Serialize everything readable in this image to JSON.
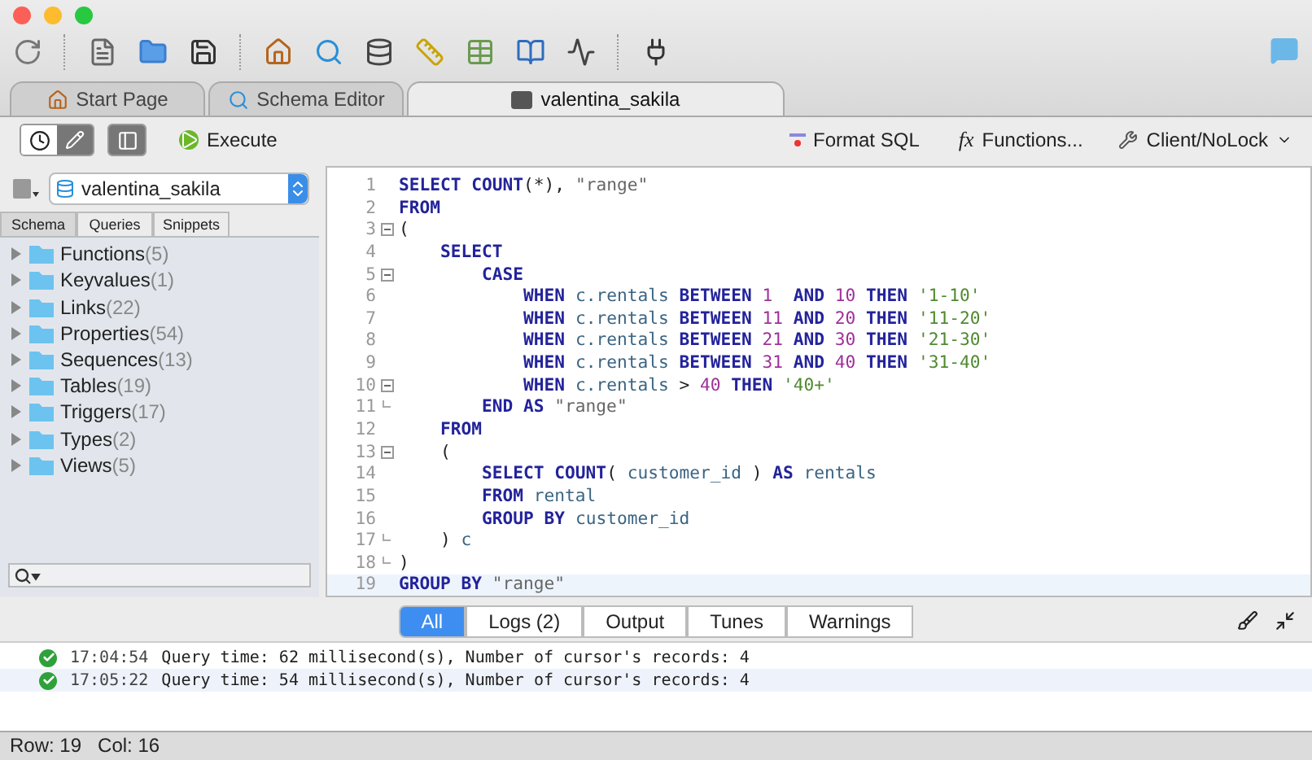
{
  "tabs": [
    {
      "label": "Start Page",
      "kind": "home",
      "selected": false
    },
    {
      "label": "Schema Editor",
      "kind": "schema",
      "selected": false
    },
    {
      "label": "valentina_sakila",
      "kind": "sql",
      "selected": true
    }
  ],
  "actions": {
    "execute": "Execute",
    "format": "Format SQL",
    "functions_icon": "fx",
    "functions": "Functions...",
    "client": "Client/NoLock"
  },
  "database": "valentina_sakila",
  "sidebar_tabs": [
    {
      "label": "Schema",
      "selected": true
    },
    {
      "label": "Queries",
      "selected": false
    },
    {
      "label": "Snippets",
      "selected": false
    }
  ],
  "tree": [
    {
      "name": "Functions",
      "count": "(5)",
      "expanded": false
    },
    {
      "name": "Keyvalues",
      "count": "(1)",
      "expanded": false
    },
    {
      "name": "Links",
      "count": "(22)",
      "expanded": false
    },
    {
      "name": "Properties",
      "count": "(54)",
      "expanded": false
    },
    {
      "name": "Sequences",
      "count": "(13)",
      "expanded": false
    },
    {
      "name": "Tables",
      "count": "(19)",
      "expanded": false
    },
    {
      "name": "Triggers",
      "count": "(17)",
      "expanded": false
    },
    {
      "name": "Types",
      "count": "(2)",
      "expanded": false
    },
    {
      "name": "Views",
      "count": "(5)",
      "expanded": false
    }
  ],
  "editor": {
    "lines": [
      {
        "number": "1",
        "tokens": [
          {
            "kind": "kw",
            "text": "SELECT COUNT"
          },
          {
            "kind": "punct",
            "text": "(*), "
          },
          {
            "kind": "qid",
            "text": "\"range\""
          }
        ]
      },
      {
        "number": "2",
        "tokens": [
          {
            "kind": "kw",
            "text": "FROM"
          }
        ]
      },
      {
        "number": "3",
        "fold_open": true,
        "tokens": [
          {
            "kind": "punct",
            "text": "("
          }
        ]
      },
      {
        "number": "4",
        "tokens": [
          {
            "kind": "kw",
            "text": "    SELECT"
          }
        ]
      },
      {
        "number": "5",
        "fold_open": true,
        "tokens": [
          {
            "kind": "kw",
            "text": "        CASE"
          }
        ]
      },
      {
        "number": "6",
        "tokens": [
          {
            "kind": "kw",
            "text": "            WHEN "
          },
          {
            "kind": "id",
            "text": "c.rentals "
          },
          {
            "kind": "kw",
            "text": "BETWEEN "
          },
          {
            "kind": "num",
            "text": "1  "
          },
          {
            "kind": "kw",
            "text": "AND "
          },
          {
            "kind": "num",
            "text": "10 "
          },
          {
            "kind": "kw",
            "text": "THEN "
          },
          {
            "kind": "str",
            "text": "'1-10'"
          }
        ]
      },
      {
        "number": "7",
        "tokens": [
          {
            "kind": "kw",
            "text": "            WHEN "
          },
          {
            "kind": "id",
            "text": "c.rentals "
          },
          {
            "kind": "kw",
            "text": "BETWEEN "
          },
          {
            "kind": "num",
            "text": "11 "
          },
          {
            "kind": "kw",
            "text": "AND "
          },
          {
            "kind": "num",
            "text": "20 "
          },
          {
            "kind": "kw",
            "text": "THEN "
          },
          {
            "kind": "str",
            "text": "'11-20'"
          }
        ]
      },
      {
        "number": "8",
        "tokens": [
          {
            "kind": "kw",
            "text": "            WHEN "
          },
          {
            "kind": "id",
            "text": "c.rentals "
          },
          {
            "kind": "kw",
            "text": "BETWEEN "
          },
          {
            "kind": "num",
            "text": "21 "
          },
          {
            "kind": "kw",
            "text": "AND "
          },
          {
            "kind": "num",
            "text": "30 "
          },
          {
            "kind": "kw",
            "text": "THEN "
          },
          {
            "kind": "str",
            "text": "'21-30'"
          }
        ]
      },
      {
        "number": "9",
        "tokens": [
          {
            "kind": "kw",
            "text": "            WHEN "
          },
          {
            "kind": "id",
            "text": "c.rentals "
          },
          {
            "kind": "kw",
            "text": "BETWEEN "
          },
          {
            "kind": "num",
            "text": "31 "
          },
          {
            "kind": "kw",
            "text": "AND "
          },
          {
            "kind": "num",
            "text": "40 "
          },
          {
            "kind": "kw",
            "text": "THEN "
          },
          {
            "kind": "str",
            "text": "'31-40'"
          }
        ]
      },
      {
        "number": "10",
        "fold_open": true,
        "tokens": [
          {
            "kind": "kw",
            "text": "            WHEN "
          },
          {
            "kind": "id",
            "text": "c.rentals "
          },
          {
            "kind": "punct",
            "text": "> "
          },
          {
            "kind": "num",
            "text": "40 "
          },
          {
            "kind": "kw",
            "text": "THEN "
          },
          {
            "kind": "str",
            "text": "'40+'"
          }
        ]
      },
      {
        "number": "11",
        "fold_end": true,
        "tokens": [
          {
            "kind": "kw",
            "text": "        END AS "
          },
          {
            "kind": "qid",
            "text": "\"range\""
          }
        ]
      },
      {
        "number": "12",
        "tokens": [
          {
            "kind": "kw",
            "text": "    FROM"
          }
        ]
      },
      {
        "number": "13",
        "fold_open": true,
        "tokens": [
          {
            "kind": "punct",
            "text": "    ("
          }
        ]
      },
      {
        "number": "14",
        "tokens": [
          {
            "kind": "kw",
            "text": "        SELECT COUNT"
          },
          {
            "kind": "punct",
            "text": "( "
          },
          {
            "kind": "id",
            "text": "customer_id "
          },
          {
            "kind": "punct",
            "text": ") "
          },
          {
            "kind": "kw",
            "text": "AS "
          },
          {
            "kind": "id",
            "text": "rentals"
          }
        ]
      },
      {
        "number": "15",
        "tokens": [
          {
            "kind": "kw",
            "text": "        FROM "
          },
          {
            "kind": "id",
            "text": "rental"
          }
        ]
      },
      {
        "number": "16",
        "tokens": [
          {
            "kind": "kw",
            "text": "        GROUP BY "
          },
          {
            "kind": "id",
            "text": "customer_id"
          }
        ]
      },
      {
        "number": "17",
        "fold_end": true,
        "tokens": [
          {
            "kind": "punct",
            "text": "    ) "
          },
          {
            "kind": "id",
            "text": "c"
          }
        ]
      },
      {
        "number": "18",
        "fold_end": true,
        "tokens": [
          {
            "kind": "punct",
            "text": ")"
          }
        ]
      },
      {
        "number": "19",
        "current": true,
        "tokens": [
          {
            "kind": "kw",
            "text": "GROUP BY "
          },
          {
            "kind": "qid",
            "text": "\"range\""
          }
        ]
      }
    ]
  },
  "log_tabs": [
    {
      "label": "All",
      "selected": true
    },
    {
      "label": "Logs (2)",
      "selected": false
    },
    {
      "label": "Output",
      "selected": false
    },
    {
      "label": "Tunes",
      "selected": false
    },
    {
      "label": "Warnings",
      "selected": false
    }
  ],
  "log": [
    {
      "success": true,
      "time": "17:04:54",
      "message": "Query time: 62 millisecond(s), Number of cursor's records: 4",
      "selected": false
    },
    {
      "success": true,
      "time": "17:05:22",
      "message": "Query time: 54 millisecond(s), Number of cursor's records: 4",
      "selected": true
    }
  ],
  "status_bar": {
    "row": "Row: 19",
    "col": "Col: 16"
  }
}
